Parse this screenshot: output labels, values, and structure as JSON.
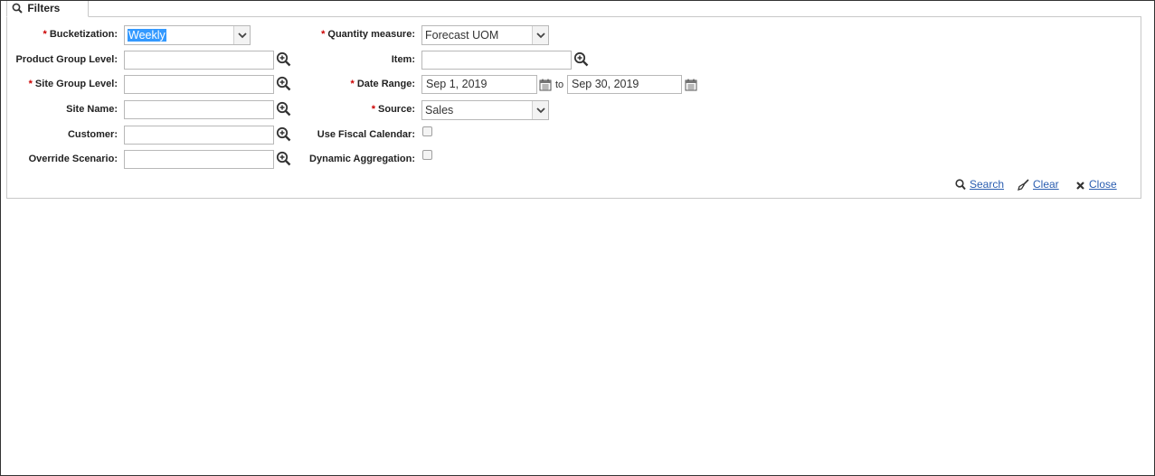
{
  "filters_tab": {
    "label": "Filters"
  },
  "left": {
    "bucketization": {
      "label": "Bucketization:",
      "value": "Weekly"
    },
    "product_group_level": {
      "label": "Product Group Level:"
    },
    "site_group_level": {
      "label": "Site Group Level:"
    },
    "site_name": {
      "label": "Site Name:"
    },
    "customer": {
      "label": "Customer:"
    },
    "override_scenario": {
      "label": "Override Scenario:"
    }
  },
  "right": {
    "quantity_measure": {
      "label": "Quantity measure:",
      "value": "Forecast UOM"
    },
    "item": {
      "label": "Item:"
    },
    "date_range": {
      "label": "Date Range:",
      "from": "Sep 1, 2019",
      "to_word": "to",
      "to": "Sep 30, 2019"
    },
    "source": {
      "label": "Source:",
      "value": "Sales"
    },
    "use_fiscal_calendar": {
      "label": "Use Fiscal Calendar:",
      "checked": false
    },
    "dynamic_aggregation": {
      "label": "Dynamic Aggregation:",
      "checked": false
    }
  },
  "required_marker": "*",
  "actions": {
    "search": "Search",
    "clear": "Clear",
    "close": "Close"
  },
  "colors": {
    "required": "#cc0000",
    "link": "#2a5db0",
    "selection": "#3399ff"
  }
}
